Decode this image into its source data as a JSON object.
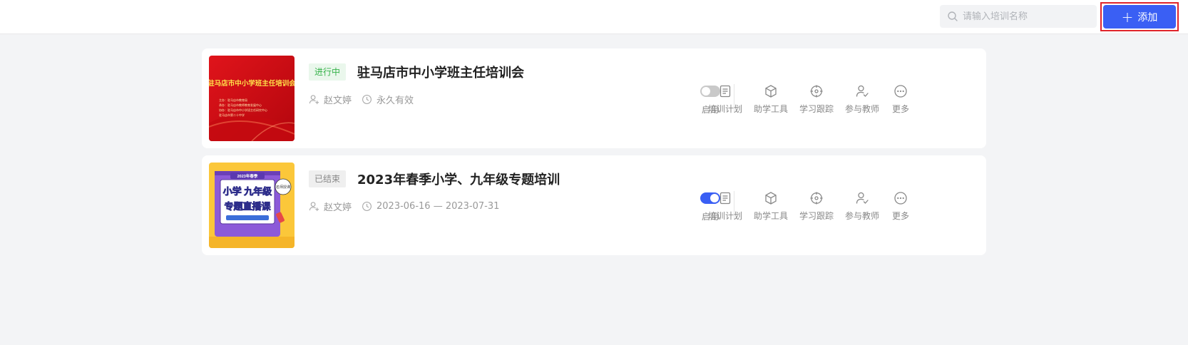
{
  "header": {
    "search_placeholder": "请输入培训名称",
    "add_label": "添加",
    "accent_color": "#3a5ff4"
  },
  "trainings": [
    {
      "status": "进行中",
      "status_color": "#36b24a",
      "title": "驻马店市中小学班主任培训会",
      "author": "赵文婷",
      "validity": "永久有效",
      "enabled": false,
      "enable_label": "启用",
      "thumbnail": {
        "headline": "驻马店市中小学班主任培训会",
        "lines": [
          "主办：驻马店市教育局",
          "承办：驻马店市教师教育发展中心",
          "协办：驻马店市中小学班主任研究中心",
          "驻马店市第二十中学"
        ]
      }
    },
    {
      "status": "已结束",
      "status_color": "#888888",
      "title": "2023年春季小学、九年级专题培训",
      "author": "赵文婷",
      "validity": "2023-06-16 — 2023-07-31",
      "enabled": true,
      "enable_label": "启用",
      "thumbnail": {
        "top": "2023年春季",
        "line1": "小学 九年级",
        "line2": "专题直播课",
        "badge": "名师授课"
      }
    }
  ],
  "actions": [
    {
      "label": "培训计划",
      "icon": "document-icon"
    },
    {
      "label": "助学工具",
      "icon": "cube-icon"
    },
    {
      "label": "学习跟踪",
      "icon": "target-icon"
    },
    {
      "label": "参与教师",
      "icon": "user-check-icon"
    },
    {
      "label": "更多",
      "icon": "more-icon"
    }
  ]
}
